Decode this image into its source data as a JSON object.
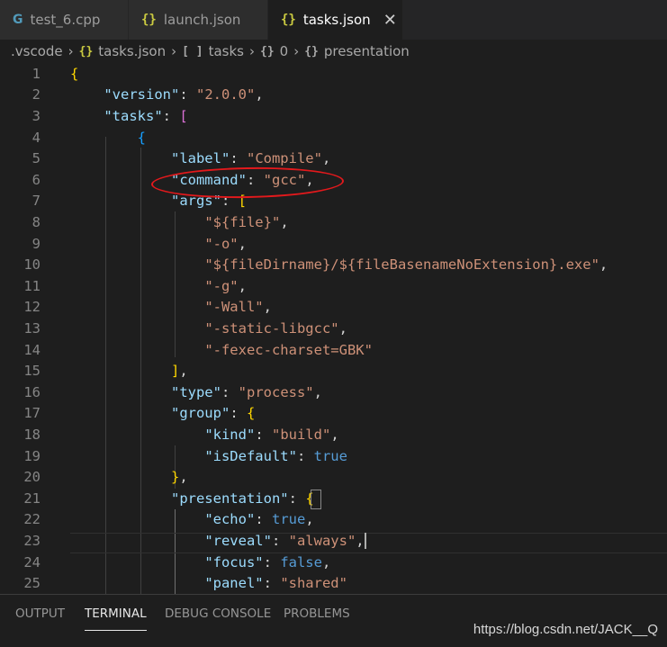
{
  "tabs": [
    {
      "icon": "G",
      "label": "test_6.cpp"
    },
    {
      "icon": "{}",
      "label": "launch.json"
    },
    {
      "icon": "{}",
      "label": "tasks.json",
      "close": "✕"
    }
  ],
  "breadcrumb": {
    "folder": ".vscode",
    "file_icon": "{}",
    "file": "tasks.json",
    "array_icon": "[ ]",
    "tasks": "tasks",
    "obj_icon": "{}",
    "index": "0",
    "obj_icon2": "{}",
    "presentation": "presentation"
  },
  "line_numbers": [
    "1",
    "2",
    "3",
    "4",
    "5",
    "6",
    "7",
    "8",
    "9",
    "10",
    "11",
    "12",
    "13",
    "14",
    "15",
    "16",
    "17",
    "18",
    "19",
    "20",
    "21",
    "22",
    "23",
    "24",
    "25"
  ],
  "code": {
    "l1_brace": "{",
    "version_key": "\"version\"",
    "version_val": "\"2.0.0\"",
    "tasks_key": "\"tasks\"",
    "tasks_open": "[",
    "obj_open": "{",
    "label_key": "\"label\"",
    "label_val": "\"Compile\"",
    "command_key": "\"command\"",
    "command_val": "\"gcc\"",
    "args_key": "\"args\"",
    "args_open": "[",
    "args": [
      "\"${file}\"",
      "\"-o\"",
      "\"${fileDirname}/${fileBasenameNoExtension}.exe\"",
      "\"-g\"",
      "\"-Wall\"",
      "\"-static-libgcc\"",
      "\"-fexec-charset=GBK\""
    ],
    "args_close": "]",
    "type_key": "\"type\"",
    "type_val": "\"process\"",
    "group_key": "\"group\"",
    "group_open": "{",
    "kind_key": "\"kind\"",
    "kind_val": "\"build\"",
    "isDefault_key": "\"isDefault\"",
    "isDefault_val": "true",
    "group_close": "}",
    "presentation_key": "\"presentation\"",
    "presentation_open": "{",
    "echo_key": "\"echo\"",
    "echo_val": "true",
    "reveal_key": "\"reveal\"",
    "reveal_val": "\"always\"",
    "focus_key": "\"focus\"",
    "focus_val": "false",
    "panel_key": "\"panel\"",
    "panel_val": "\"shared\""
  },
  "panel": {
    "tabs": [
      "OUTPUT",
      "TERMINAL",
      "DEBUG CONSOLE",
      "PROBLEMS"
    ],
    "active": "TERMINAL"
  },
  "watermark": "https://blog.csdn.net/JACK__Q",
  "colors": {
    "background": "#1e1e1e",
    "key": "#9cdcfe",
    "string": "#ce9178",
    "boolean": "#569cd6",
    "annotation": "#e3191c"
  }
}
